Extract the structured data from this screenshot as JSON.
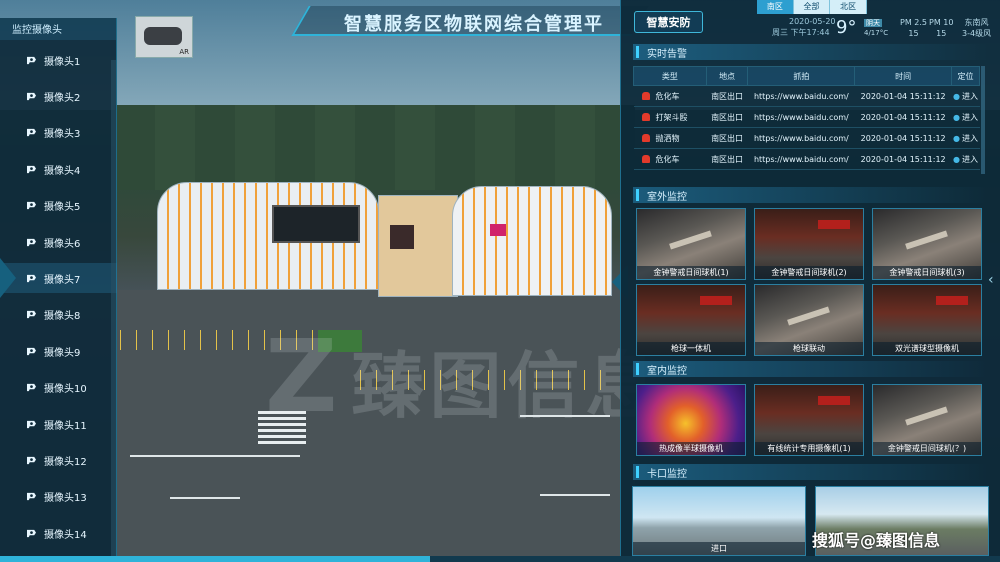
{
  "app": {
    "title": "智慧服务区物联网综合管理平",
    "subsystem": "智慧安防"
  },
  "map_thumb": {
    "label": "AR"
  },
  "sidebar": {
    "heading": "监控摄像头",
    "items": [
      {
        "label": "摄像头1"
      },
      {
        "label": "摄像头2"
      },
      {
        "label": "摄像头3"
      },
      {
        "label": "摄像头4"
      },
      {
        "label": "摄像头5"
      },
      {
        "label": "摄像头6"
      },
      {
        "label": "摄像头7"
      },
      {
        "label": "摄像头8"
      },
      {
        "label": "摄像头9"
      },
      {
        "label": "摄像头10"
      },
      {
        "label": "摄像头11"
      },
      {
        "label": "摄像头12"
      },
      {
        "label": "摄像头13"
      },
      {
        "label": "摄像头14"
      }
    ],
    "selected_index": 6
  },
  "area_tabs": [
    {
      "label": "南区",
      "active": true
    },
    {
      "label": "全部",
      "active": false
    },
    {
      "label": "北区",
      "active": false
    }
  ],
  "status": {
    "date": "2020-05-20",
    "time": "周三 下午17:44",
    "temperature": "9°",
    "weather_badge": "阴天",
    "weather_range": "4/17°C",
    "pm25_label": "PM 2.5",
    "pm25_value": "15",
    "pm10_label": "PM 10",
    "pm10_value": "15",
    "wind_dir": "东南风",
    "wind_level": "3-4级风"
  },
  "alerts": {
    "heading": "实时告警",
    "columns": [
      "类型",
      "地点",
      "抓拍",
      "时间",
      "定位"
    ],
    "rows": [
      {
        "type": "危化车",
        "location": "南区出口",
        "capture": "https://www.baidu.com/",
        "time": "2020-01-04 15:11:12",
        "action": "进入"
      },
      {
        "type": "打架斗殴",
        "location": "南区出口",
        "capture": "https://www.baidu.com/",
        "time": "2020-01-04 15:11:12",
        "action": "进入"
      },
      {
        "type": "抛洒物",
        "location": "南区出口",
        "capture": "https://www.baidu.com/",
        "time": "2020-01-04 15:11:12",
        "action": "进入"
      },
      {
        "type": "危化车",
        "location": "南区出口",
        "capture": "https://www.baidu.com/",
        "time": "2020-01-04 15:11:12",
        "action": "进入"
      }
    ]
  },
  "outdoor": {
    "heading": "室外监控",
    "items": [
      {
        "caption": "金钟警戒日间球机(1)",
        "scene": "mall"
      },
      {
        "caption": "金钟警戒日间球机(2)",
        "scene": "store"
      },
      {
        "caption": "金钟警戒日间球机(3)",
        "scene": "mall"
      },
      {
        "caption": "枪球一体机",
        "scene": "store"
      },
      {
        "caption": "枪球联动",
        "scene": "mall"
      },
      {
        "caption": "双光谱球型摄像机",
        "scene": "store"
      }
    ]
  },
  "indoor": {
    "heading": "室内监控",
    "items": [
      {
        "caption": "热成像半球摄像机",
        "scene": "thermal"
      },
      {
        "caption": "有线统计专用摄像机(1)",
        "scene": "store"
      },
      {
        "caption": "金钟警戒日间球机(？)",
        "scene": "mall"
      }
    ]
  },
  "gate": {
    "heading": "卡口监控",
    "items": [
      {
        "caption": "进口",
        "scene": "outside"
      },
      {
        "caption": "",
        "scene": "outside2"
      }
    ]
  },
  "watermark": {
    "text": "臻图信息"
  },
  "credit": {
    "text": "搜狐号@臻图信息"
  },
  "playback": {
    "progress": 0.43
  }
}
